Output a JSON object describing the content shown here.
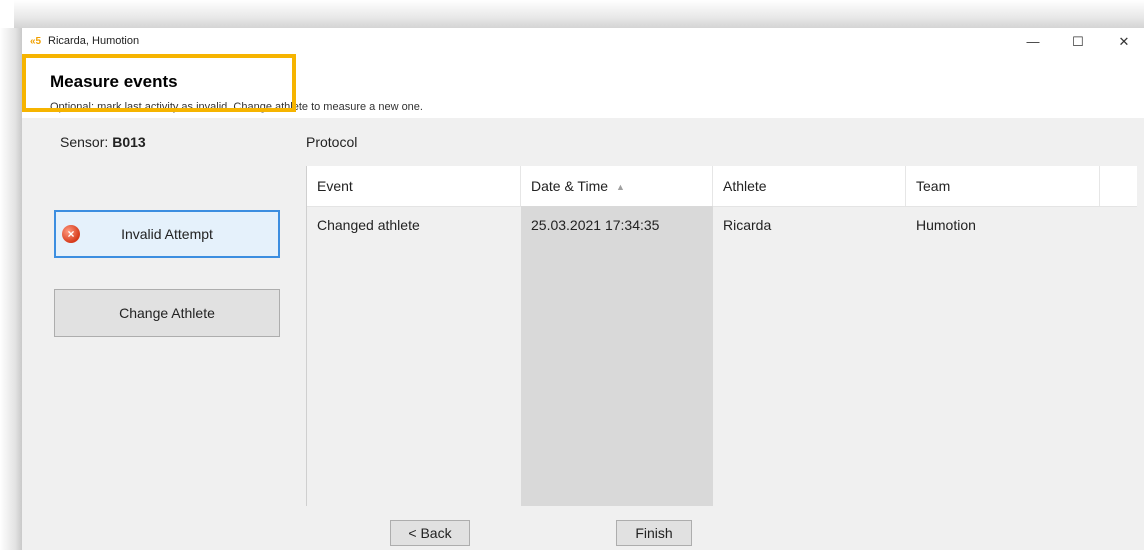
{
  "window": {
    "app_icon": "«5",
    "title": "Ricarda, Humotion",
    "minimize": "—",
    "maximize": "☐",
    "close": "✕"
  },
  "header": {
    "title": "Measure events",
    "subtitle": "Optional: mark last activity as invalid. Change athlete to measure a new one."
  },
  "sensor": {
    "label": "Sensor:",
    "value": "B013"
  },
  "actions": {
    "invalid_attempt": "Invalid Attempt",
    "invalid_icon": "error-icon",
    "change_athlete": "Change Athlete"
  },
  "protocol": {
    "label": "Protocol",
    "columns": [
      "Event",
      "Date & Time",
      "Athlete",
      "Team"
    ],
    "sort_indicator": "▲",
    "rows": [
      [
        "Changed athlete",
        "25.03.2021 17:34:35",
        "Ricarda",
        "Humotion"
      ]
    ]
  },
  "footer": {
    "back": "< Back",
    "finish": "Finish"
  },
  "colors": {
    "highlight": "#f6b400",
    "focus_border": "#3c8ee0",
    "error_icon": "#d63a1a"
  }
}
